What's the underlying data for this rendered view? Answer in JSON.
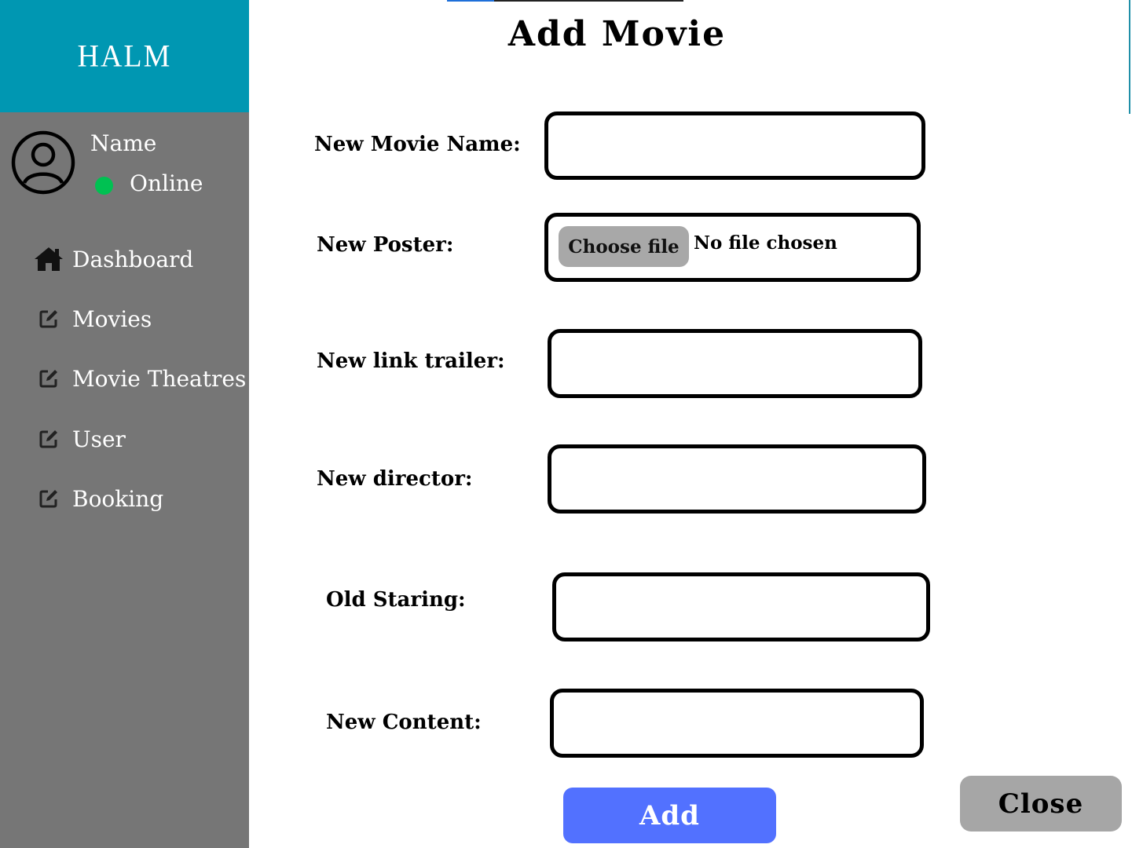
{
  "sidebar": {
    "brand": "HALM",
    "user": {
      "name": "Name",
      "status": "Online"
    },
    "items": [
      {
        "label": "Dashboard",
        "icon": "home-icon"
      },
      {
        "label": "Movies",
        "icon": "edit-icon"
      },
      {
        "label": "Movie Theatres",
        "icon": "edit-icon"
      },
      {
        "label": "User",
        "icon": "edit-icon"
      },
      {
        "label": "Booking",
        "icon": "edit-icon"
      }
    ]
  },
  "form": {
    "title": "Add Movie",
    "fields": {
      "movie_name": {
        "label": "New  Movie Name:",
        "value": ""
      },
      "poster": {
        "label": "New Poster:",
        "button": "Choose file",
        "status": "No file chosen"
      },
      "trailer": {
        "label": "New link trailer:",
        "value": ""
      },
      "director": {
        "label": "New director:",
        "value": ""
      },
      "starring": {
        "label": "Old Staring:",
        "value": ""
      },
      "content": {
        "label": "New Content:",
        "value": ""
      }
    },
    "add_label": "Add",
    "close_label": "Close"
  },
  "colors": {
    "brand_bg": "#0097b2",
    "sidebar_bg": "#767676",
    "online": "#00c152",
    "add_button": "#5271ff",
    "close_button": "#a6a6a6"
  }
}
